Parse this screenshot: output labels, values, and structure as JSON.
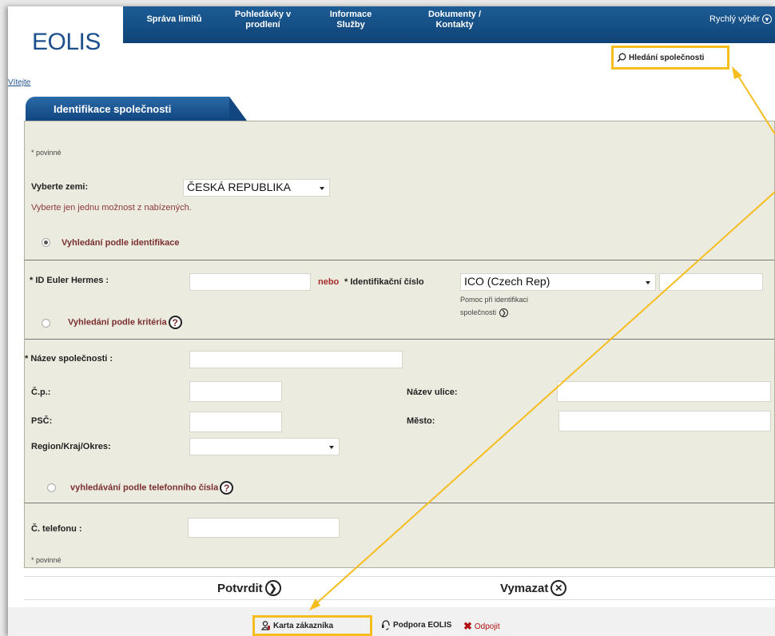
{
  "header": {
    "logo_text": "EOLIS",
    "nav": [
      {
        "label": "Správa limitů"
      },
      {
        "label": "Pohledávky v prodlení"
      },
      {
        "label": "Informace Služby"
      },
      {
        "label": "Dokumenty / Kontakty"
      }
    ],
    "quick_select": "Rychlý výběr",
    "company_search": "Hledání společnosti",
    "welcome": "Vítejte"
  },
  "form": {
    "tab_title": "Identifikace společnosti",
    "required_note": "* povinné",
    "country_label": "Vyberte zemi:",
    "country_value": "ČESKÁ REPUBLIKA",
    "country_hint": "Vyberte jen jednu možnost z nabízených.",
    "section_identification": "Vyhledání podle identifikace",
    "euler_id_label": "* ID Euler Hermes :",
    "or_label": "nebo",
    "id_number_label": "* Identifikační číslo",
    "id_type_value": "ICO (Czech Rep)",
    "help_text_line1": "Pomoc při identifikaci",
    "help_text_line2": "společnosti",
    "section_criteria": "Vyhledání podle kritéria",
    "company_name_label": "* Název společnosti :",
    "house_number_label": "Č.p.:",
    "street_label": "Název ulice:",
    "zip_label": "PSČ:",
    "city_label": "Město:",
    "region_label": "Region/Kraj/Okres:",
    "section_phone": "vyhledávání podle telefonního čísla",
    "phone_label": "Č. telefonu :",
    "required_note_bottom": "* povinné"
  },
  "buttons": {
    "confirm": "Potvrdit",
    "clear": "Vymazat"
  },
  "footer": {
    "customer_card": "Karta zákazníka",
    "support": "Podpora EOLIS",
    "logout": "Odpojit"
  },
  "colors": {
    "nav_bg": "#0f4377",
    "highlight": "#f6bd1e",
    "panel_bg": "#ecebe0",
    "section_text": "#7a2f2f"
  }
}
